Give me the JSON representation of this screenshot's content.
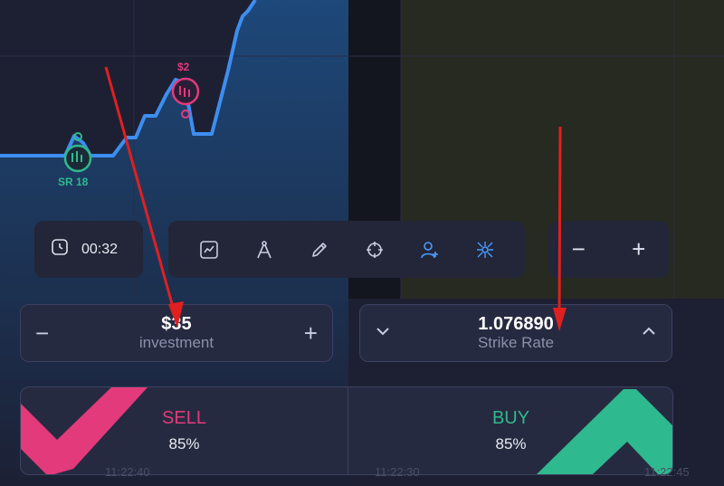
{
  "colors": {
    "sell": "#e23a7b",
    "buy": "#2fb98e",
    "line": "#3d8ef0",
    "accent": "#4a9cff",
    "annotation": "#e02020"
  },
  "markers": {
    "sell_label": "$2",
    "buy_label": "SR 18"
  },
  "timer": {
    "icon": "clock-icon",
    "value": "00:32"
  },
  "toolbar": {
    "tools": [
      "chart-type-icon",
      "compass-icon",
      "pencil-icon",
      "crosshair-icon",
      "user-add-icon",
      "network-icon"
    ]
  },
  "zoom": {
    "minus": "−",
    "plus": "+"
  },
  "investment": {
    "minus": "−",
    "value": "$35",
    "label": "investment",
    "plus": "+"
  },
  "strike": {
    "down": "chevron-down-icon",
    "value": "1.076890",
    "label": "Strike Rate",
    "up": "chevron-up-icon"
  },
  "trade": {
    "sell_label": "SELL",
    "sell_pct": "85%",
    "buy_label": "BUY",
    "buy_pct": "85%"
  },
  "time_axis": [
    "11:22:40",
    "11:22:30",
    "11:22:45"
  ]
}
